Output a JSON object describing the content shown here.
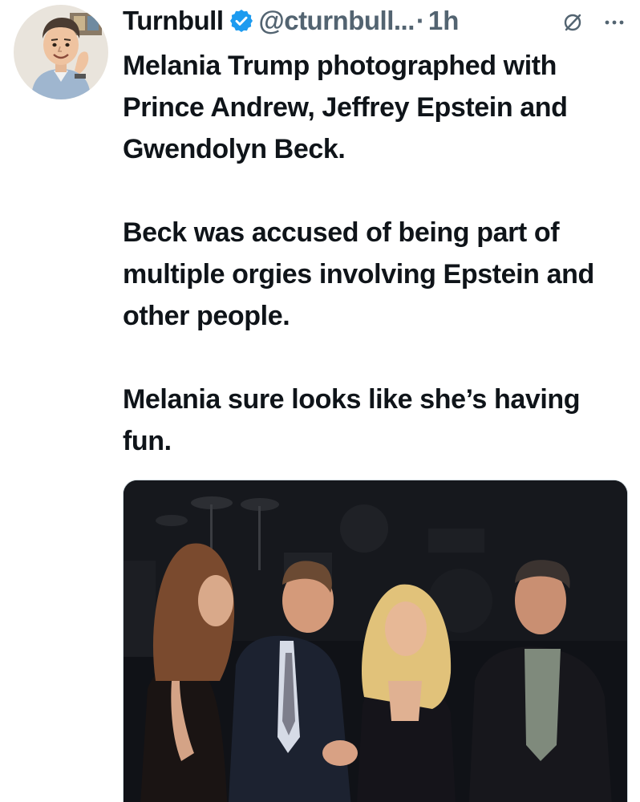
{
  "tweet": {
    "author": {
      "display_name": "Turnbull",
      "handle": "@cturnbull...",
      "verified_icon": "verified-badge-icon",
      "avatar_icon": "cartoon-avatar"
    },
    "separator": "·",
    "timestamp": "1h",
    "header_icons": [
      "grok-icon",
      "more-options-icon"
    ],
    "text": {
      "paragraph_1": "Melania Trump photographed with Prince Andrew, Jeffrey Epstein and Gwendolyn Beck.",
      "paragraph_2": "Beck was accused of being part of multiple orgies involving Epstein and other people.",
      "paragraph_3": "Melania sure looks like she’s having fun."
    },
    "media": {
      "type": "photo"
    }
  },
  "colors": {
    "text_primary": "#0f1419",
    "text_secondary": "#536471",
    "verified_blue": "#1d9bf0"
  }
}
